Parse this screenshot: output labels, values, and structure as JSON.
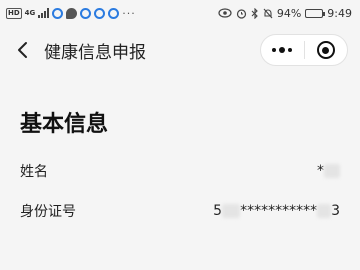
{
  "status_bar": {
    "hd": "HD",
    "network": "4G",
    "more": "···",
    "battery_percent": "94%",
    "battery_level": 0.94,
    "time": "9:49"
  },
  "nav": {
    "title": "健康信息申报"
  },
  "section": {
    "title": "基本信息"
  },
  "fields": {
    "name": {
      "label": "姓名",
      "value_prefix": "*"
    },
    "id_number": {
      "label": "身份证号",
      "value_start": "5",
      "value_mask": "***********",
      "value_end": "3"
    }
  }
}
